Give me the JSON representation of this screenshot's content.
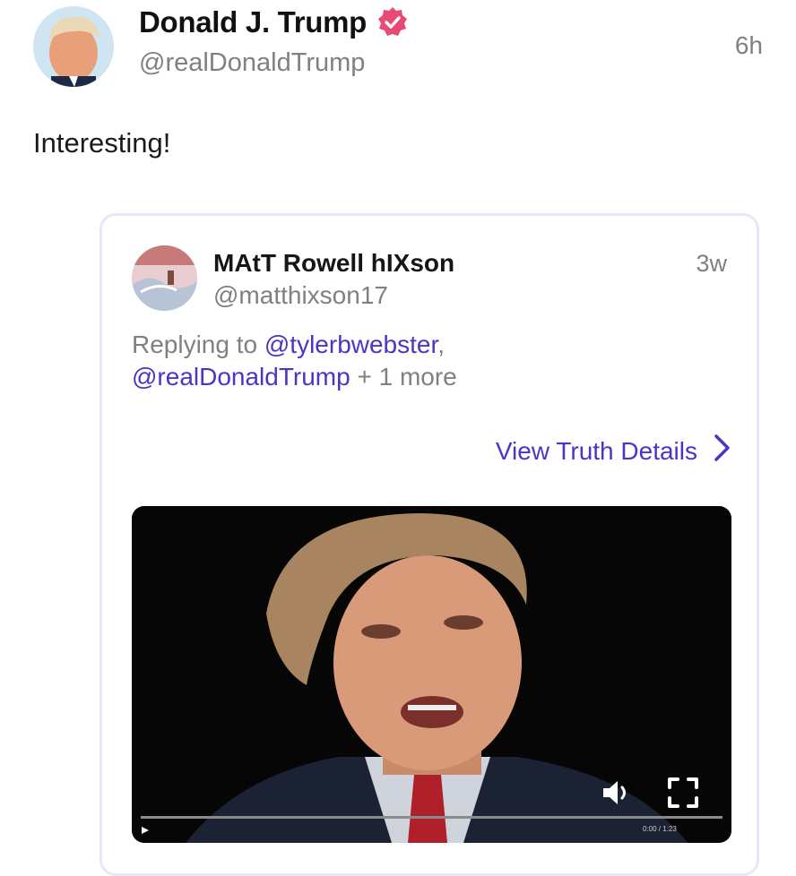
{
  "post": {
    "display_name": "Donald J. Trump",
    "handle": "@realDonaldTrump",
    "time": "6h",
    "text": "Interesting!",
    "verified_badge_icon": "verified-badge-icon",
    "accent_color": "#e94a74"
  },
  "quote": {
    "display_name": "MAtT Rowell hIXson",
    "handle": "@matthixson17",
    "time": "3w",
    "replying_prefix": "Replying to ",
    "mention_1": "@tylerbwebster",
    "mention_1_suffix": ",",
    "mention_2": "@realDonaldTrump",
    "more_text": " + 1 more",
    "view_details": "View Truth Details",
    "link_color": "#4a35c7"
  },
  "video": {
    "time_readout": "0:00 / 1:23",
    "progress": 0.0,
    "icons": [
      "volume-icon",
      "fullscreen-icon",
      "play-icon"
    ]
  }
}
